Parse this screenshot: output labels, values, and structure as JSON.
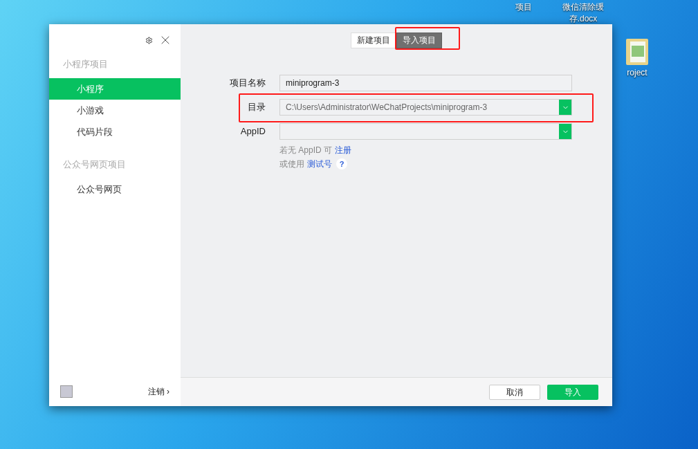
{
  "desktop_icons": [
    {
      "label": "项目",
      "kind": "text"
    },
    {
      "label": "微信清除缓存.docx",
      "kind": "text"
    },
    {
      "label": "roject",
      "kind": "folder"
    }
  ],
  "window": {
    "sidebar": {
      "sections": [
        {
          "title": "小程序项目",
          "items": [
            {
              "label": "小程序",
              "selected": true
            },
            {
              "label": "小游戏",
              "selected": false
            },
            {
              "label": "代码片段",
              "selected": false
            }
          ]
        },
        {
          "title": "公众号网页项目",
          "items": [
            {
              "label": "公众号网页",
              "selected": false
            }
          ]
        }
      ],
      "logout": "注销",
      "logout_arrow": "›"
    },
    "tabs": [
      {
        "label": "新建项目",
        "selected": false,
        "highlighted": false
      },
      {
        "label": "导入项目",
        "selected": true,
        "highlighted": true
      }
    ],
    "fields": [
      {
        "label": "项目名称",
        "value": "miniprogram-3",
        "kind": "text",
        "highlighted": false
      },
      {
        "label": "目录",
        "value": "C:\\Users\\Administrator\\WeChatProjects\\miniprogram-3",
        "kind": "select",
        "highlighted": true
      },
      {
        "label": "AppID",
        "kind": "select",
        "highlighted": false
      }
    ],
    "hints": [
      {
        "text": "若无 AppID 可",
        "link": "注册"
      },
      {
        "text": "或使用",
        "link": "测试号",
        "help_text": "?"
      }
    ],
    "buttons": [
      {
        "label": "取消",
        "kind": "secondary"
      },
      {
        "label": "导入",
        "kind": "primary"
      }
    ]
  }
}
